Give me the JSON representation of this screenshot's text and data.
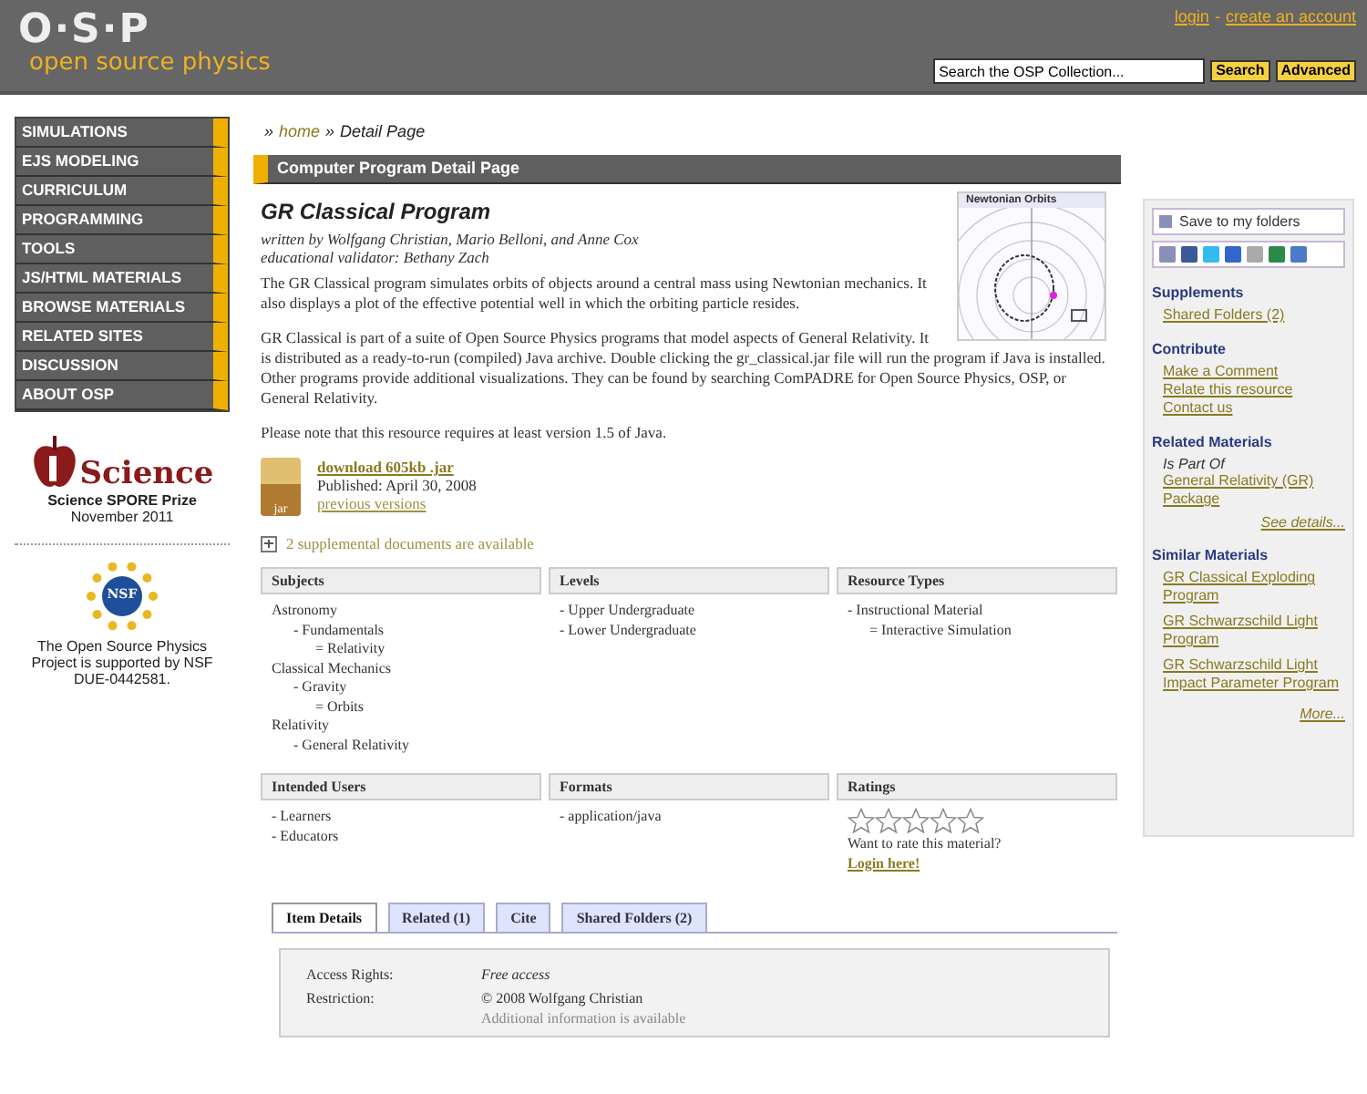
{
  "header": {
    "logo_mark": "O·S·P",
    "logo_text": "open source physics",
    "links": [
      "login",
      "create an account"
    ],
    "link_separator": "-",
    "search": {
      "placeholder": "Search the OSP Collection..."
    },
    "buttons": [
      "Search",
      "Advanced"
    ]
  },
  "nav": {
    "items": [
      "SIMULATIONS",
      "EJS MODELING",
      "CURRICULUM",
      "PROGRAMMING",
      "TOOLS",
      "JS/HTML MATERIALS",
      "BROWSE MATERIALS",
      "RELATED SITES",
      "DISCUSSION",
      "ABOUT OSP"
    ]
  },
  "awards": [
    {
      "kind": "apple",
      "logo_word": "Science",
      "lines": [
        "Science SPORE Prize",
        "November 2011"
      ]
    },
    {
      "kind": "nsf",
      "logo_word": "NSF",
      "lines": [
        "The Open Source Physics Project is supported by NSF DUE-0442581."
      ]
    }
  ],
  "breadcrumb": {
    "sep": "»",
    "home": "home",
    "current": "Detail Page"
  },
  "section_bar": {
    "title": "Computer Program Detail Page"
  },
  "resource": {
    "title": "GR Classical Program",
    "authors": "written by Wolfgang Christian, Mario Belloni, and Anne Cox",
    "validator": "educational validator: Bethany Zach",
    "paragraphs": [
      "The GR Classical program simulates orbits of objects around a central mass using Newtonian mechanics.  It also displays a plot of the effective potential well in which the orbiting particle resides.",
      "GR Classical is part of a suite of Open Source Physics programs that model aspects of General Relativity.  It is distributed as a ready-to-run (compiled) Java archive.  Double clicking the gr_classical.jar file will run the program if Java is installed.  Other programs provide additional visualizations.  They can be found by searching ComPADRE for Open Source Physics, OSP, or General Relativity.",
      "Please note that this resource requires at least version 1.5 of Java."
    ],
    "thumbnail": {
      "title": "Newtonian Orbits"
    },
    "download": {
      "file_label": "jar",
      "link": "download 605kb .jar",
      "published": "Published: April 30, 2008",
      "previous": "previous versions"
    },
    "supplemental": {
      "expanded": false,
      "text": "2 supplemental documents are available"
    }
  },
  "facets": [
    {
      "heading": "Subjects",
      "items": [
        {
          "label": "Astronomy",
          "children": [
            {
              "label": "- Fundamentals",
              "children": [
                {
                  "label": "= Relativity"
                }
              ]
            }
          ]
        },
        {
          "label": "Classical Mechanics",
          "children": [
            {
              "label": "- Gravity",
              "children": [
                {
                  "label": "= Orbits"
                }
              ]
            }
          ]
        },
        {
          "label": "Relativity",
          "children": [
            {
              "label": "- General Relativity"
            }
          ]
        }
      ]
    },
    {
      "heading": "Levels",
      "items": [
        {
          "label": "- Upper Undergraduate"
        },
        {
          "label": "- Lower Undergraduate"
        }
      ]
    },
    {
      "heading": "Resource Types",
      "items": [
        {
          "label": "- Instructional Material",
          "children": [
            {
              "label": "= Interactive Simulation"
            }
          ]
        }
      ]
    },
    {
      "heading": "Intended Users",
      "items": [
        {
          "label": "- Learners"
        },
        {
          "label": "- Educators"
        }
      ]
    },
    {
      "heading": "Formats",
      "items": [
        {
          "label": "- application/java"
        }
      ]
    },
    {
      "heading": "Ratings",
      "kind": "rating",
      "stars": 0,
      "prompt": "Want to rate this material?",
      "link": "Login here!"
    }
  ],
  "tabs": [
    {
      "label": "Item Details",
      "selected": true
    },
    {
      "label": "Related (1)",
      "selected": false
    },
    {
      "label": "Cite",
      "selected": false
    },
    {
      "label": "Shared Folders (2)",
      "selected": false
    }
  ],
  "details": [
    {
      "label": "Access Rights:",
      "value": "Free access",
      "italic": true
    },
    {
      "label": "Restriction:",
      "value": "© 2008 Wolfgang Christian",
      "italic": false,
      "extra": "Additional information is available"
    }
  ],
  "sidebar": {
    "save": "Save to my folders",
    "sections": [
      {
        "title": "Supplements",
        "links": [
          "Shared Folders (2)"
        ]
      },
      {
        "title": "Contribute",
        "links": [
          "Make a Comment",
          "Relate this resource",
          "Contact us"
        ]
      },
      {
        "title": "Related Materials",
        "note": "Is Part Of",
        "links": [
          "General Relativity (GR) Package"
        ],
        "more": "See details..."
      },
      {
        "title": "Similar Materials",
        "links": [
          "GR Classical Exploding Program",
          "GR Schwarzschild Light Program",
          "GR Schwarzschild Light Impact Parameter Program"
        ],
        "more": "More..."
      }
    ]
  }
}
